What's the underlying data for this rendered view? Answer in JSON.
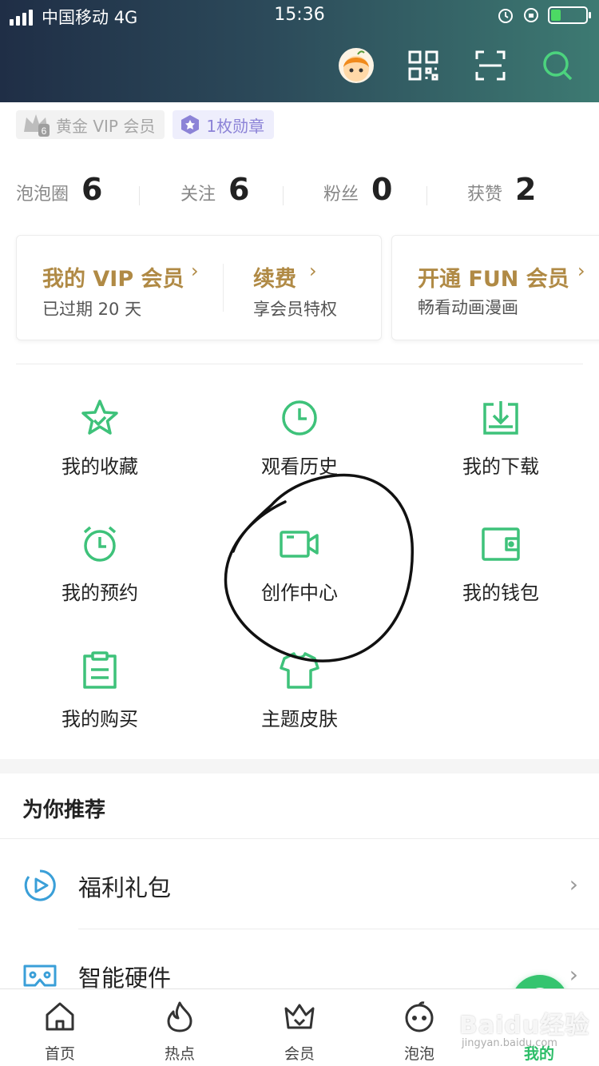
{
  "status_bar": {
    "carrier": "中国移动",
    "network": "4G",
    "time": "15:36"
  },
  "badges": {
    "vip_level": "6",
    "vip": "黄金 VIP 会员",
    "medal": "1枚勋章"
  },
  "stats": [
    {
      "label": "泡泡圈",
      "value": "6"
    },
    {
      "label": "关注",
      "value": "6"
    },
    {
      "label": "粉丝",
      "value": "0"
    },
    {
      "label": "获赞",
      "value": "2"
    }
  ],
  "vip_cards": {
    "my_vip_title": "我的 VIP 会员",
    "my_vip_sub": "已过期 20 天",
    "renew_title": "续费",
    "renew_sub": "享会员特权",
    "fun_title": "开通 FUN 会员",
    "fun_sub": "畅看动画漫画",
    "chevron": "›"
  },
  "grid": [
    {
      "label": "我的收藏",
      "icon": "star-icon"
    },
    {
      "label": "观看历史",
      "icon": "clock-icon"
    },
    {
      "label": "我的下载",
      "icon": "download-icon"
    },
    {
      "label": "我的预约",
      "icon": "alarm-icon"
    },
    {
      "label": "创作中心",
      "icon": "video-camera-icon"
    },
    {
      "label": "我的钱包",
      "icon": "wallet-icon"
    },
    {
      "label": "我的购买",
      "icon": "clipboard-icon"
    },
    {
      "label": "主题皮肤",
      "icon": "tshirt-icon"
    }
  ],
  "recommend": {
    "title": "为你推荐",
    "items": [
      {
        "label": "福利礼包",
        "icon": "play-circle-icon"
      },
      {
        "label": "智能硬件",
        "icon": "vr-headset-icon"
      }
    ],
    "chevron": "›"
  },
  "tabbar": [
    {
      "label": "首页",
      "icon": "home-icon",
      "active": false
    },
    {
      "label": "热点",
      "icon": "flame-icon",
      "active": false
    },
    {
      "label": "会员",
      "icon": "crown-icon",
      "active": false
    },
    {
      "label": "泡泡",
      "icon": "bubble-face-icon",
      "active": false
    },
    {
      "label": "我的",
      "icon": "profile-icon",
      "active": true
    }
  ],
  "watermark": {
    "main": "Baidu经验",
    "sub": "jingyan.baidu.com"
  },
  "colors": {
    "accent_green": "#3ec27a",
    "gold": "#b08a45",
    "medal_purple": "#8c83d7"
  }
}
